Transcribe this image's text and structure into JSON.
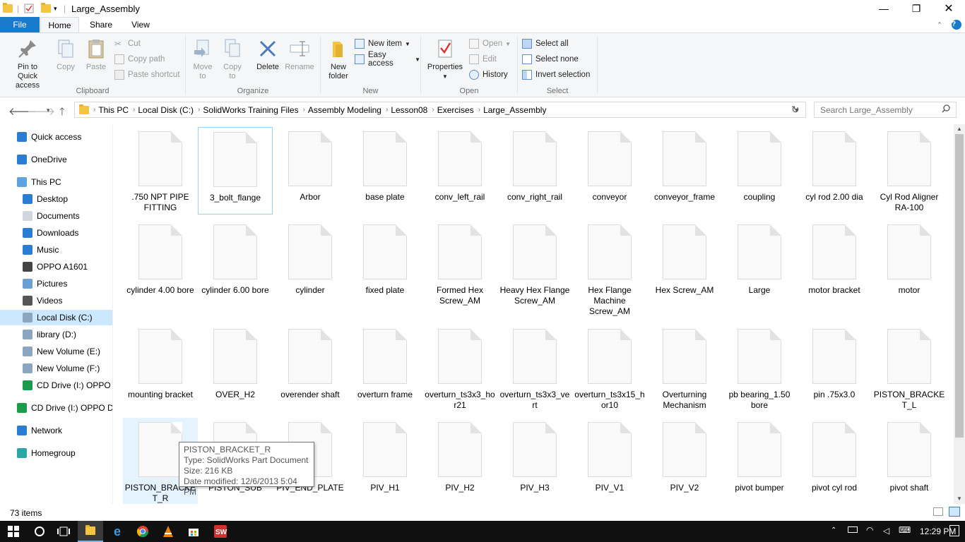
{
  "window": {
    "title": "Large_Assembly"
  },
  "ribbon_tabs": [
    "File",
    "Home",
    "Share",
    "View"
  ],
  "ribbon": {
    "clipboard": {
      "label": "Clipboard",
      "pin": "Pin to Quick access",
      "copy": "Copy",
      "paste": "Paste",
      "cut": "Cut",
      "copy_path": "Copy path",
      "paste_shortcut": "Paste shortcut"
    },
    "organize": {
      "label": "Organize",
      "move_to": "Move to",
      "copy_to": "Copy to",
      "delete": "Delete",
      "rename": "Rename"
    },
    "new": {
      "label": "New",
      "new_folder": "New folder",
      "new_item": "New item",
      "easy_access": "Easy access"
    },
    "open": {
      "label": "Open",
      "properties": "Properties",
      "open": "Open",
      "edit": "Edit",
      "history": "History"
    },
    "select": {
      "label": "Select",
      "select_all": "Select all",
      "select_none": "Select none",
      "invert": "Invert selection"
    }
  },
  "address": {
    "crumbs": [
      "This PC",
      "Local Disk (C:)",
      "SolidWorks Training Files",
      "Assembly Modeling",
      "Lesson08",
      "Exercises",
      "Large_Assembly"
    ],
    "search_placeholder": "Search Large_Assembly"
  },
  "nav": [
    {
      "label": "Quick access",
      "icon": "star-icon"
    },
    {
      "label": "OneDrive",
      "icon": "cloud-icon"
    },
    {
      "label": "This PC",
      "icon": "computer-icon"
    },
    {
      "label": "Desktop",
      "icon": "desktop-icon"
    },
    {
      "label": "Documents",
      "icon": "documents-icon"
    },
    {
      "label": "Downloads",
      "icon": "downloads-icon"
    },
    {
      "label": "Music",
      "icon": "music-icon"
    },
    {
      "label": "OPPO A1601",
      "icon": "phone-icon"
    },
    {
      "label": "Pictures",
      "icon": "pictures-icon"
    },
    {
      "label": "Videos",
      "icon": "videos-icon"
    },
    {
      "label": "Local Disk (C:)",
      "icon": "drive-icon"
    },
    {
      "label": "library (D:)",
      "icon": "drive-icon"
    },
    {
      "label": "New Volume (E:)",
      "icon": "drive-icon"
    },
    {
      "label": "New Volume (F:)",
      "icon": "drive-icon"
    },
    {
      "label": "CD Drive (I:) OPPO I",
      "icon": "cd-drive-icon"
    },
    {
      "label": "CD Drive (I:) OPPO Dr",
      "icon": "cd-drive-icon"
    },
    {
      "label": "Network",
      "icon": "network-icon"
    },
    {
      "label": "Homegroup",
      "icon": "homegroup-icon"
    }
  ],
  "files": [
    ".750 NPT PIPE FITTING",
    "3_bolt_flange",
    "Arbor",
    "base plate",
    "conv_left_rail",
    "conv_right_rail",
    "conveyor",
    "conveyor_frame",
    "coupling",
    "cyl rod 2.00 dia",
    "Cyl Rod Aligner RA-100",
    "cylinder 4.00 bore",
    "cylinder 6.00 bore",
    "cylinder",
    "fixed plate",
    "Formed Hex Screw_AM",
    "Heavy Hex Flange Screw_AM",
    "Hex Flange Machine Screw_AM",
    "Hex Screw_AM",
    "Large",
    "motor bracket",
    "motor",
    "mounting bracket",
    "OVER_H2",
    "overender shaft",
    "overturn frame",
    "overturn_ts3x3_hor21",
    "overturn_ts3x3_vert",
    "overturn_ts3x15_hor10",
    "Overturning Mechanism",
    "pb bearing_1.50 bore",
    "pin .75x3.0",
    "PISTON_BRACKET_L",
    "PISTON_BRACKET_R",
    "PISTON_SUB",
    "PIV_END_PLATE",
    "PIV_H1",
    "PIV_H2",
    "PIV_H3",
    "PIV_V1",
    "PIV_V2",
    "pivot bumper",
    "pivot cyl rod",
    "pivot shaft"
  ],
  "tooltip": {
    "name": "PISTON_BRACKET_R",
    "type": "Type: SolidWorks Part Document",
    "size": "Size: 216 KB",
    "modified": "Date modified: 12/6/2013 5:04 PM"
  },
  "status": {
    "items": "73 items"
  },
  "taskbar": {
    "time": "12:29 PM"
  },
  "colors": {
    "accent": "#1979ca",
    "selection": "#cce8ff"
  }
}
